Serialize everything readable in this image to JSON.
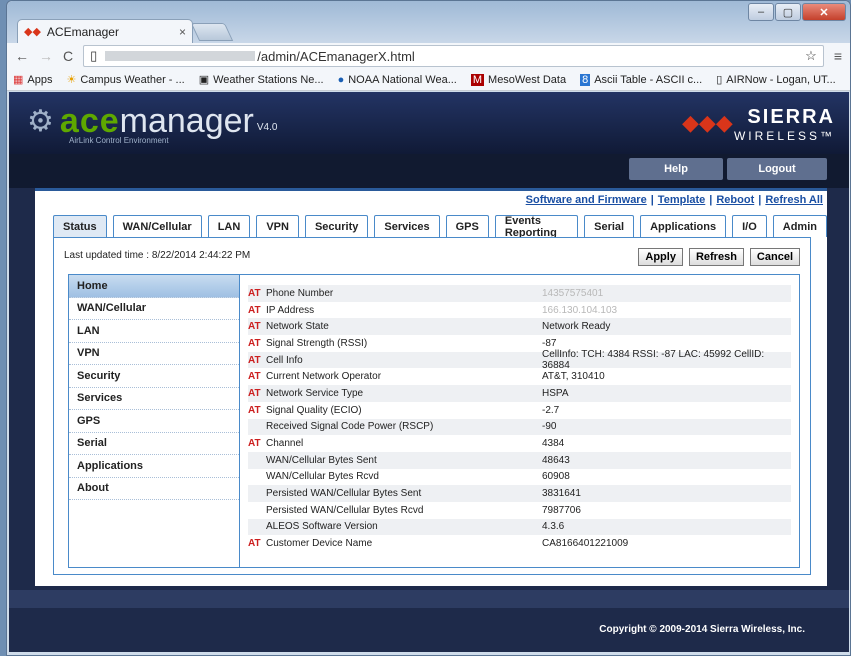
{
  "browser": {
    "tab_title": "ACEmanager",
    "tab_close": "×",
    "url_suffix": "/admin/ACEmanagerX.html",
    "bookmarks": [
      {
        "label": "Apps",
        "icon": "grid"
      },
      {
        "label": "Campus Weather - ...",
        "icon": "sun"
      },
      {
        "label": "Weather Stations Ne...",
        "icon": "doc"
      },
      {
        "label": "NOAA National Wea...",
        "icon": "noaa"
      },
      {
        "label": "MesoWest Data",
        "icon": "m"
      },
      {
        "label": "Ascii Table - ASCII c...",
        "icon": "8"
      },
      {
        "label": "AIRNow - Logan, UT...",
        "icon": "page"
      }
    ],
    "more": "»"
  },
  "header": {
    "logo_ace": "ace",
    "logo_manager": "manager",
    "logo_version": "V4.0",
    "logo_sub": "AirLink Control Environment",
    "brand_line1": "SIERRA",
    "brand_line2": "WIRELESS™"
  },
  "nav": {
    "help": "Help",
    "logout": "Logout"
  },
  "links": [
    "Software and Firmware",
    "Template",
    "Reboot",
    "Refresh All"
  ],
  "tabs": [
    "Status",
    "WAN/Cellular",
    "LAN",
    "VPN",
    "Security",
    "Services",
    "GPS",
    "Events Reporting",
    "Serial",
    "Applications",
    "I/O",
    "Admin"
  ],
  "updated": "Last updated time : 8/22/2014 2:44:22 PM",
  "buttons": {
    "apply": "Apply",
    "refresh": "Refresh",
    "cancel": "Cancel"
  },
  "sidebar": [
    "Home",
    "WAN/Cellular",
    "LAN",
    "VPN",
    "Security",
    "Services",
    "GPS",
    "Serial",
    "Applications",
    "About"
  ],
  "rows": [
    {
      "at": "AT",
      "label": "Phone Number",
      "value": "14357575401",
      "blur": true
    },
    {
      "at": "AT",
      "label": "IP Address",
      "value": "166.130.104.103",
      "blur": true
    },
    {
      "at": "AT",
      "label": "Network State",
      "value": "Network Ready"
    },
    {
      "at": "AT",
      "label": "Signal Strength (RSSI)",
      "value": "-87"
    },
    {
      "at": "AT",
      "label": "Cell Info",
      "value": "CellInfo: TCH: 4384 RSSI: -87 LAC: 45992 CellID: 36884"
    },
    {
      "at": "AT",
      "label": "Current Network Operator",
      "value": "AT&T, 310410"
    },
    {
      "at": "AT",
      "label": "Network Service Type",
      "value": "HSPA"
    },
    {
      "at": "AT",
      "label": "Signal Quality (ECIO)",
      "value": "-2.7"
    },
    {
      "at": "",
      "label": "Received Signal Code Power (RSCP)",
      "value": "-90"
    },
    {
      "at": "AT",
      "label": "Channel",
      "value": "4384"
    },
    {
      "at": "",
      "label": "WAN/Cellular Bytes Sent",
      "value": "48643"
    },
    {
      "at": "",
      "label": "WAN/Cellular Bytes Rcvd",
      "value": "60908"
    },
    {
      "at": "",
      "label": "Persisted WAN/Cellular Bytes Sent",
      "value": "3831641"
    },
    {
      "at": "",
      "label": "Persisted WAN/Cellular Bytes Rcvd",
      "value": "7987706"
    },
    {
      "at": "",
      "label": "ALEOS Software Version",
      "value": "4.3.6"
    },
    {
      "at": "AT",
      "label": "Customer Device Name",
      "value": "CA8166401221009"
    }
  ],
  "copyright": "Copyright © 2009-2014 Sierra Wireless, Inc."
}
